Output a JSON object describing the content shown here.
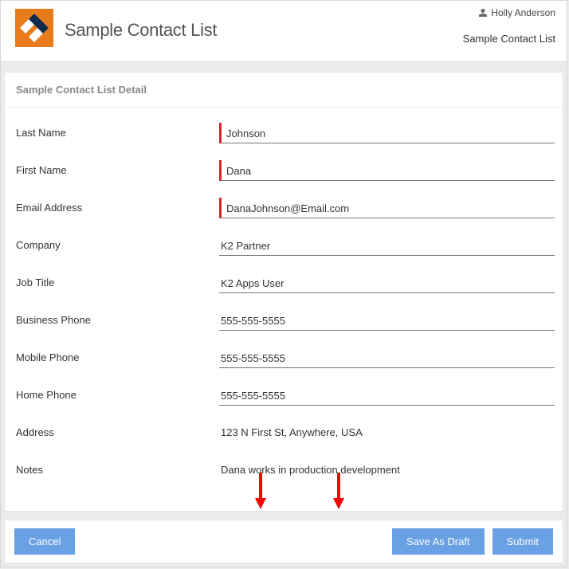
{
  "header": {
    "title": "Sample Contact List",
    "user_name": "Holly Anderson",
    "breadcrumb": "Sample Contact List"
  },
  "panel": {
    "title": "Sample Contact List Detail"
  },
  "fields": {
    "last_name": {
      "label": "Last Name",
      "value": "Johnson"
    },
    "first_name": {
      "label": "First Name",
      "value": "Dana"
    },
    "email": {
      "label": "Email Address",
      "value": "DanaJohnson@Email.com"
    },
    "company": {
      "label": "Company",
      "value": "K2 Partner"
    },
    "job_title": {
      "label": "Job Title",
      "value": "K2 Apps User"
    },
    "business_phone": {
      "label": "Business Phone",
      "value": "555-555-5555"
    },
    "mobile_phone": {
      "label": "Mobile Phone",
      "value": "555-555-5555"
    },
    "home_phone": {
      "label": "Home Phone",
      "value": "555-555-5555"
    },
    "address": {
      "label": "Address",
      "value": "123 N First St, Anywhere, USA"
    },
    "notes": {
      "label": "Notes",
      "value": "Dana works in production development"
    }
  },
  "buttons": {
    "cancel": "Cancel",
    "save_draft": "Save As Draft",
    "submit": "Submit"
  }
}
